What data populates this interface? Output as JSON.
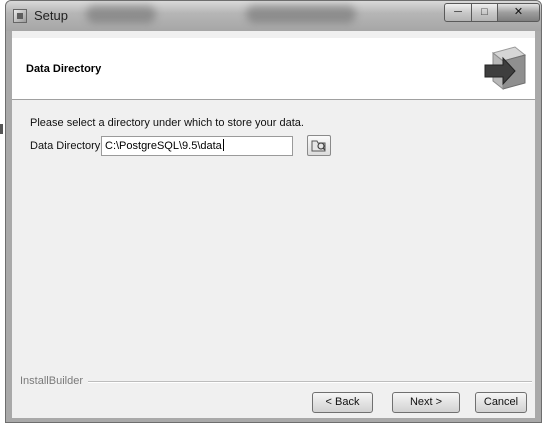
{
  "window": {
    "title": "Setup",
    "controls": {
      "minimize_icon": "minimize-icon",
      "maximize_icon": "maximize-icon",
      "close_icon": "close-icon"
    }
  },
  "header": {
    "title": "Data Directory",
    "icon": "installer-box-arrow-icon"
  },
  "body": {
    "prompt": "Please select a directory under which to store your data.",
    "directory_label": "Data Directory",
    "directory_value": "C:\\PostgreSQL\\9.5\\data",
    "browse_icon": "folder-browse-icon"
  },
  "footer": {
    "brand": "InstallBuilder",
    "back_label": "< Back",
    "next_label": "Next >",
    "cancel_label": "Cancel"
  },
  "colors": {
    "frame": "#a9a9a9",
    "client": "#f0f0f0",
    "header_bg": "#ffffff"
  }
}
